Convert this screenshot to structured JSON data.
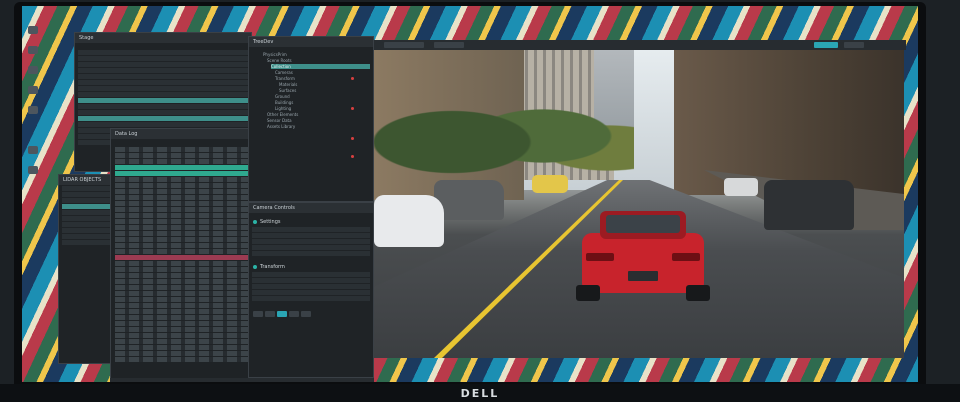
{
  "monitor": {
    "brand": "DELL"
  },
  "panels": {
    "outliner": {
      "title": "Stage"
    },
    "scene_tree": {
      "title": "TreeDev"
    },
    "data_panel": {
      "title": "Data Log"
    },
    "attributes": {
      "title": "Camera Controls",
      "section_settings": "Settings",
      "section_transform": "Transform"
    },
    "list_panel": {
      "title": "LIDAR OBJECTS"
    }
  },
  "scene_tree_items": [
    "PhysicsPrim",
    "Scene Roots",
    "Collection",
    "Cameras",
    "Transform",
    "Materials",
    "Surfaces",
    "Ground",
    "Buildings",
    "Lighting",
    "Other Elements",
    "Sensor Data",
    "Assets Library"
  ],
  "colors": {
    "accent": "#2aa5b4",
    "highlight": "#2fa98f",
    "alert": "#9c3b52",
    "car": "#c8232c"
  }
}
